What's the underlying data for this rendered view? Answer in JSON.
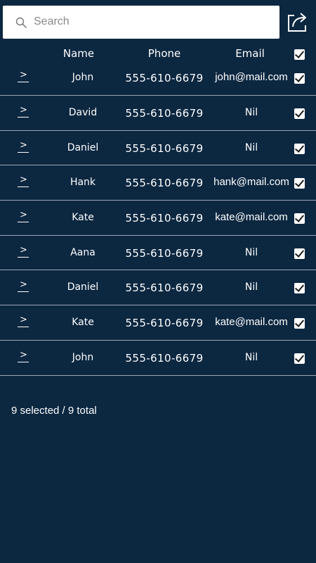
{
  "search": {
    "placeholder": "Search",
    "value": ""
  },
  "table": {
    "columns": {
      "name": "Name",
      "phone": "Phone",
      "email": "Email"
    },
    "select_all_checked": true,
    "rows": [
      {
        "name": "John",
        "phone": "555-610-6679",
        "email": "john@mail.com",
        "checked": true
      },
      {
        "name": "David",
        "phone": "555-610-6679",
        "email": "Nil",
        "checked": true
      },
      {
        "name": "Daniel",
        "phone": "555-610-6679",
        "email": "Nil",
        "checked": true
      },
      {
        "name": "Hank",
        "phone": "555-610-6679",
        "email": "hank@mail.com",
        "checked": true
      },
      {
        "name": "Kate",
        "phone": "555-610-6679",
        "email": "kate@mail.com",
        "checked": true
      },
      {
        "name": "Aana",
        "phone": "555-610-6679",
        "email": "Nil",
        "checked": true
      },
      {
        "name": "Daniel",
        "phone": "555-610-6679",
        "email": "Nil",
        "checked": true
      },
      {
        "name": "Kate",
        "phone": "555-610-6679",
        "email": "kate@mail.com",
        "checked": true
      },
      {
        "name": "John",
        "phone": "555-610-6679",
        "email": "Nil",
        "checked": true
      }
    ]
  },
  "status": {
    "text": "9 selected / 9 total"
  },
  "icons": {
    "search": "search-icon",
    "share": "share-icon",
    "row_expand": "chevron-right-icon",
    "checkbox": "checkbox-checked-icon"
  },
  "colors": {
    "background": "#0c2740",
    "divider": "#9aa9b8",
    "text": "#ffffff"
  }
}
